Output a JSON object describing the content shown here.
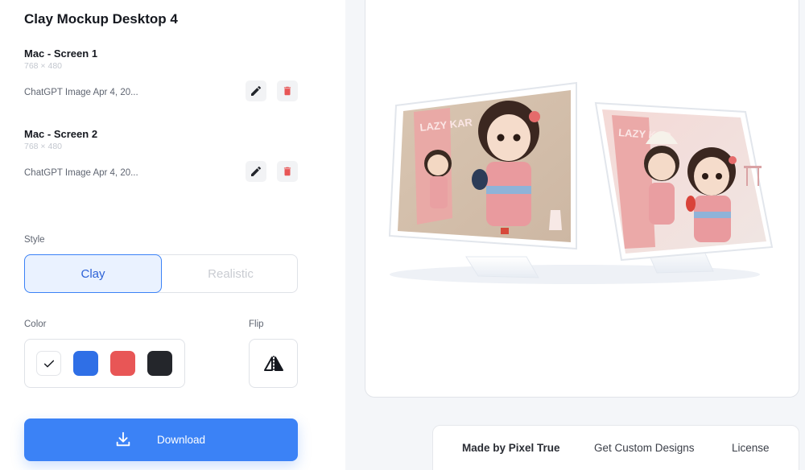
{
  "app": {
    "title": "Clay Mockup Desktop 4"
  },
  "screens": [
    {
      "name": "Mac - Screen 1",
      "dims": "768 × 480",
      "file": "ChatGPT Image Apr 4, 20..."
    },
    {
      "name": "Mac - Screen 2",
      "dims": "768 × 480",
      "file": "ChatGPT Image Apr 4, 20..."
    }
  ],
  "style": {
    "label": "Style",
    "options": [
      "Clay",
      "Realistic"
    ],
    "selected": "Clay"
  },
  "color": {
    "label": "Color",
    "swatches": [
      {
        "name": "white",
        "hex": "#ffffff",
        "selected": true
      },
      {
        "name": "blue",
        "hex": "#2f6fe6",
        "selected": false
      },
      {
        "name": "red",
        "hex": "#e85656",
        "selected": false
      },
      {
        "name": "black",
        "hex": "#24262b",
        "selected": false
      }
    ]
  },
  "flip": {
    "label": "Flip"
  },
  "download": {
    "label": "Download"
  },
  "preview": {
    "screen1_text": "LAZY KAR",
    "screen2_text": "LAZY KAR"
  },
  "footer": {
    "credit": "Made by Pixel True",
    "custom": "Get Custom Designs",
    "license": "License"
  },
  "colors": {
    "accent": "#3b82f6",
    "delete": "#e85656"
  }
}
